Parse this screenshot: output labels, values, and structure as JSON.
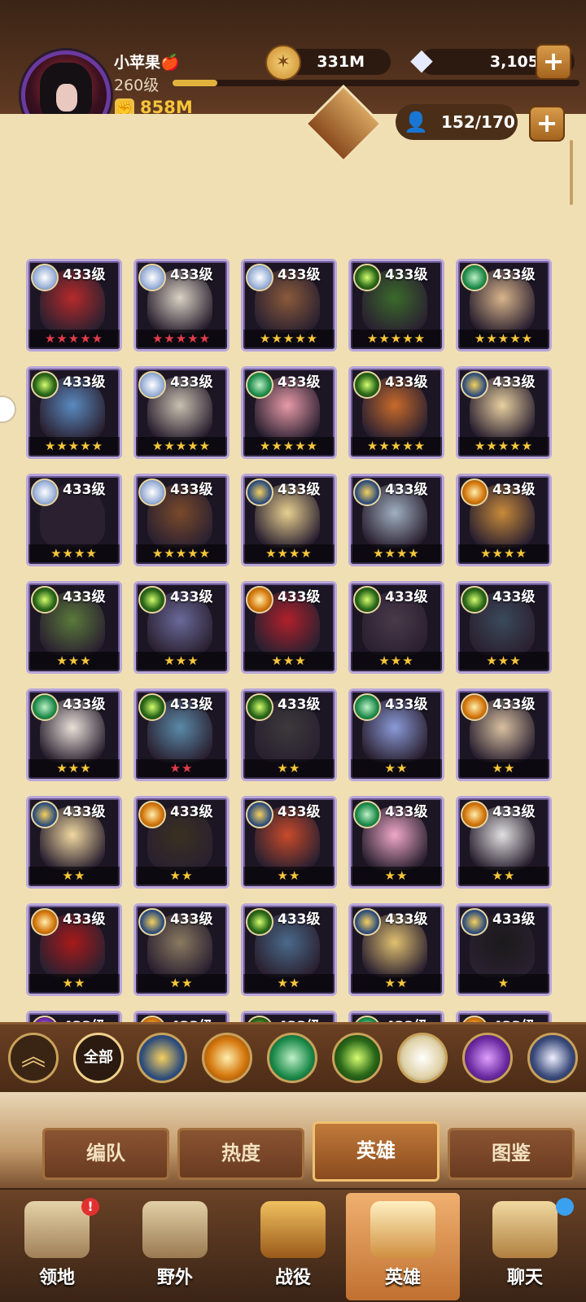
{
  "player": {
    "name": "小苹果🍎",
    "level": "260级",
    "power": "858M",
    "xp_fraction": 0.11
  },
  "resources": {
    "gold": "331M",
    "gems": "3,105"
  },
  "roster": {
    "count": "152/170"
  },
  "colors": {
    "gold_star": "#f7c73a",
    "red_star": "#e23c4a",
    "card_border": "#b9a7d8"
  },
  "heroes": [
    {
      "level": "433级",
      "stars": "★★★★★",
      "star_color": "red",
      "faction": "celestial",
      "tone": "#b52a2a"
    },
    {
      "level": "433级",
      "stars": "★★★★★",
      "star_color": "red",
      "faction": "celestial",
      "tone": "#d9d2c4"
    },
    {
      "level": "433级",
      "stars": "★★★★★",
      "star_color": "gold",
      "faction": "celestial",
      "tone": "#8a5a3a"
    },
    {
      "level": "433级",
      "stars": "★★★★★",
      "star_color": "gold",
      "faction": "mauler",
      "tone": "#3a6a2a"
    },
    {
      "level": "433级",
      "stars": "★★★★★",
      "star_color": "gold",
      "faction": "wilder",
      "tone": "#d8b48a"
    },
    {
      "level": "433级",
      "stars": "★★★★★",
      "star_color": "gold",
      "faction": "mauler",
      "tone": "#5a8ac0"
    },
    {
      "level": "433级",
      "stars": "★★★★★",
      "star_color": "gold",
      "faction": "celestial",
      "tone": "#c8c0b0"
    },
    {
      "level": "433级",
      "stars": "★★★★★",
      "star_color": "gold",
      "faction": "wilder",
      "tone": "#e89aa8"
    },
    {
      "level": "433级",
      "stars": "★★★★★",
      "star_color": "gold",
      "faction": "mauler",
      "tone": "#c86a2a"
    },
    {
      "level": "433级",
      "stars": "★★★★★",
      "star_color": "gold",
      "faction": "lightbearer",
      "tone": "#e8d0a0"
    },
    {
      "level": "433级",
      "stars": "★★★★",
      "star_color": "gold",
      "faction": "celestial",
      "tone": "#2a2030"
    },
    {
      "level": "433级",
      "stars": "★★★★★",
      "star_color": "gold",
      "faction": "celestial",
      "tone": "#7a4a2a"
    },
    {
      "level": "433级",
      "stars": "★★★★",
      "star_color": "gold",
      "faction": "lightbearer",
      "tone": "#e8d090"
    },
    {
      "level": "433级",
      "stars": "★★★★",
      "star_color": "gold",
      "faction": "lightbearer",
      "tone": "#a0b0c0"
    },
    {
      "level": "433级",
      "stars": "★★★★",
      "star_color": "gold",
      "faction": "graveborn",
      "tone": "#c88a3a"
    },
    {
      "level": "433级",
      "stars": "★★★",
      "star_color": "gold",
      "faction": "mauler",
      "tone": "#5a7a3a"
    },
    {
      "level": "433级",
      "stars": "★★★",
      "star_color": "gold",
      "faction": "mauler",
      "tone": "#6a6a9a"
    },
    {
      "level": "433级",
      "stars": "★★★",
      "star_color": "gold",
      "faction": "graveborn",
      "tone": "#b0202a"
    },
    {
      "level": "433级",
      "stars": "★★★",
      "star_color": "gold",
      "faction": "mauler",
      "tone": "#4a3a4a"
    },
    {
      "level": "433级",
      "stars": "★★★",
      "star_color": "gold",
      "faction": "mauler",
      "tone": "#3a4a5a"
    },
    {
      "level": "433级",
      "stars": "★★★",
      "star_color": "gold",
      "faction": "wilder",
      "tone": "#e8e0d8"
    },
    {
      "level": "433级",
      "stars": "★★",
      "star_color": "red",
      "faction": "mauler",
      "tone": "#5a8aa8"
    },
    {
      "level": "433级",
      "stars": "★★",
      "star_color": "gold",
      "faction": "mauler",
      "tone": "#3a3a3a"
    },
    {
      "level": "433级",
      "stars": "★★",
      "star_color": "gold",
      "faction": "wilder",
      "tone": "#8a9ad8"
    },
    {
      "level": "433级",
      "stars": "★★",
      "star_color": "gold",
      "faction": "graveborn",
      "tone": "#d8c0a0"
    },
    {
      "level": "433级",
      "stars": "★★",
      "star_color": "gold",
      "faction": "lightbearer",
      "tone": "#f0d8a0"
    },
    {
      "level": "433级",
      "stars": "★★",
      "star_color": "gold",
      "faction": "graveborn",
      "tone": "#3a3020"
    },
    {
      "level": "433级",
      "stars": "★★",
      "star_color": "gold",
      "faction": "lightbearer",
      "tone": "#c84a2a"
    },
    {
      "level": "433级",
      "stars": "★★",
      "star_color": "gold",
      "faction": "wilder",
      "tone": "#f0a8c8"
    },
    {
      "level": "433级",
      "stars": "★★",
      "star_color": "gold",
      "faction": "graveborn",
      "tone": "#e0e0e0"
    },
    {
      "level": "433级",
      "stars": "★★",
      "star_color": "gold",
      "faction": "graveborn",
      "tone": "#a81a1a"
    },
    {
      "level": "433级",
      "stars": "★★",
      "star_color": "gold",
      "faction": "lightbearer",
      "tone": "#8a7a60"
    },
    {
      "level": "433级",
      "stars": "★★",
      "star_color": "gold",
      "faction": "mauler",
      "tone": "#4a6a8a"
    },
    {
      "level": "433级",
      "stars": "★★",
      "star_color": "gold",
      "faction": "lightbearer",
      "tone": "#e0c070"
    },
    {
      "level": "433级",
      "stars": "★",
      "star_color": "gold",
      "faction": "lightbearer",
      "tone": "#1a1a1a"
    },
    {
      "level": "433级",
      "stars": "★",
      "star_color": "gold",
      "faction": "hypogean",
      "tone": "#a02a4a"
    },
    {
      "level": "433级",
      "stars": "★",
      "star_color": "gold",
      "faction": "graveborn",
      "tone": "#c8602a"
    },
    {
      "level": "433级",
      "stars": "★",
      "star_color": "gold",
      "faction": "mauler",
      "tone": "#5a6a4a"
    },
    {
      "level": "433级",
      "stars": "★",
      "star_color": "gold",
      "faction": "wilder",
      "tone": "#d8b48a"
    },
    {
      "level": "433级",
      "stars": "★",
      "star_color": "gold",
      "faction": "graveborn",
      "tone": "#b0504a"
    }
  ],
  "filters": {
    "collapse_icon": "double-chevron-up-icon",
    "all_label": "全部",
    "factions": [
      "lightbearer",
      "graveborn",
      "wilder",
      "mauler",
      "celestial",
      "hypogean",
      "dimensional"
    ]
  },
  "tabs": [
    {
      "label": "编队",
      "active": false
    },
    {
      "label": "热度",
      "active": false
    },
    {
      "label": "英雄",
      "active": true
    },
    {
      "label": "图鉴",
      "active": false
    }
  ],
  "nav": [
    {
      "label": "领地",
      "icon": "castle-icon",
      "badge": "!"
    },
    {
      "label": "野外",
      "icon": "scroll-map-icon",
      "badge": ""
    },
    {
      "label": "战役",
      "icon": "sword-shield-icon",
      "badge": ""
    },
    {
      "label": "英雄",
      "icon": "helmet-icon",
      "badge": ""
    },
    {
      "label": "聊天",
      "icon": "chat-icon",
      "badge": "dot"
    }
  ]
}
